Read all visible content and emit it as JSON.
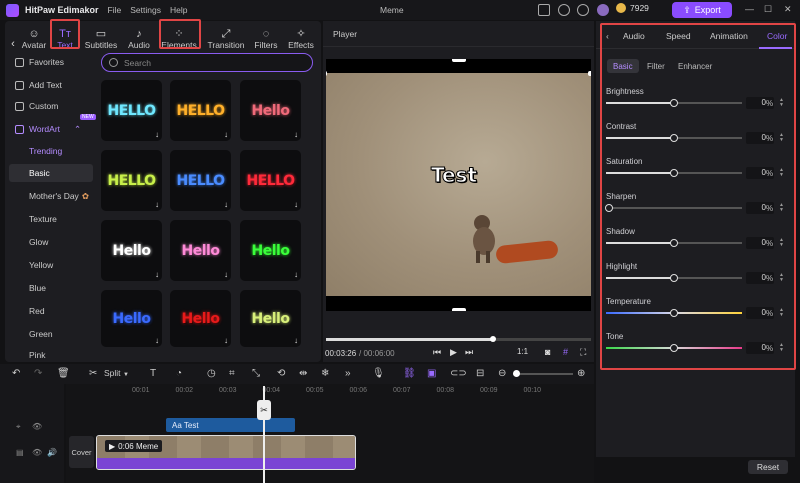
{
  "titlebar": {
    "app_name": "HitPaw Edimakor",
    "menus": [
      "File",
      "Settings",
      "Help"
    ],
    "project_name": "Meme",
    "credits": "7929",
    "export_label": "Export"
  },
  "left_tabs": [
    {
      "label": "Avatar",
      "icon": "avatar-icon"
    },
    {
      "label": "Text",
      "icon": "text-icon"
    },
    {
      "label": "Subtitles",
      "icon": "subtitles-icon"
    },
    {
      "label": "Audio",
      "icon": "audio-icon"
    },
    {
      "label": "Elements",
      "icon": "elements-icon"
    },
    {
      "label": "Transition",
      "icon": "transition-icon"
    },
    {
      "label": "Filters",
      "icon": "filters-icon"
    },
    {
      "label": "Effects",
      "icon": "effects-icon"
    }
  ],
  "categories": {
    "favorites": "Favorites",
    "add_text": "Add Text",
    "custom": "Custom",
    "wordart": "WordArt",
    "new_badge": "NEW",
    "subs": [
      "Trending",
      "Basic",
      "Mother's Day",
      "Texture",
      "Glow",
      "Yellow",
      "Blue",
      "Red",
      "Green",
      "Pink"
    ]
  },
  "search": {
    "placeholder": "Search"
  },
  "wordart_tiles": [
    {
      "text": "HELLO",
      "color": "#6fe8ff"
    },
    {
      "text": "HELLO",
      "color": "#ffb02a"
    },
    {
      "text": "Hello",
      "color": "#f06a7a"
    },
    {
      "text": "HELLO",
      "color": "#c8f04a"
    },
    {
      "text": "HELLO",
      "color": "#4a8cff"
    },
    {
      "text": "HELLO",
      "color": "#ff2a3a"
    },
    {
      "text": "Hello",
      "color": "#ffffff"
    },
    {
      "text": "Hello",
      "color": "#ff8ad8"
    },
    {
      "text": "Hello",
      "color": "#3aff3a"
    },
    {
      "text": "Hello",
      "color": "#3a6aff"
    },
    {
      "text": "Hello",
      "color": "#e81a1a"
    },
    {
      "text": "Hello",
      "color": "#d8f07a"
    }
  ],
  "player": {
    "header": "Player",
    "overlay_text": "Test",
    "time_current": "00:03:26",
    "time_total": "/ 00:06:00",
    "progress": 0.63,
    "ratio": "1:1"
  },
  "right_panel": {
    "tabs": [
      "Audio",
      "Speed",
      "Animation",
      "Color"
    ],
    "subtabs": [
      "Basic",
      "Filter",
      "Enhancer"
    ],
    "sliders": [
      {
        "label": "Brightness",
        "value": "0",
        "unit": "%",
        "pos": 0.5,
        "kind": "plain"
      },
      {
        "label": "Contrast",
        "value": "0",
        "unit": "%",
        "pos": 0.5,
        "kind": "plain"
      },
      {
        "label": "Saturation",
        "value": "0",
        "unit": "%",
        "pos": 0.5,
        "kind": "plain"
      },
      {
        "label": "Sharpen",
        "value": "0",
        "unit": "%",
        "pos": 0.0,
        "kind": "plain"
      },
      {
        "label": "Shadow",
        "value": "0",
        "unit": "%",
        "pos": 0.5,
        "kind": "plain"
      },
      {
        "label": "Highlight",
        "value": "0",
        "unit": "%",
        "pos": 0.5,
        "kind": "plain"
      },
      {
        "label": "Temperature",
        "value": "0",
        "unit": "%",
        "pos": 0.5,
        "kind": "temp"
      },
      {
        "label": "Tone",
        "value": "0",
        "unit": "%",
        "pos": 0.5,
        "kind": "tone"
      }
    ],
    "reset_label": "Reset"
  },
  "toolbar": {
    "split_label": "Split"
  },
  "ruler_ticks": [
    "00:01",
    "00:02",
    "00:03",
    "00:04",
    "00:05",
    "00:06",
    "00:07",
    "00:08",
    "00:09",
    "00:10"
  ],
  "timeline": {
    "text_clip": "Aa Test",
    "video_clip": "0:06 Meme",
    "cover_label": "Cover"
  }
}
